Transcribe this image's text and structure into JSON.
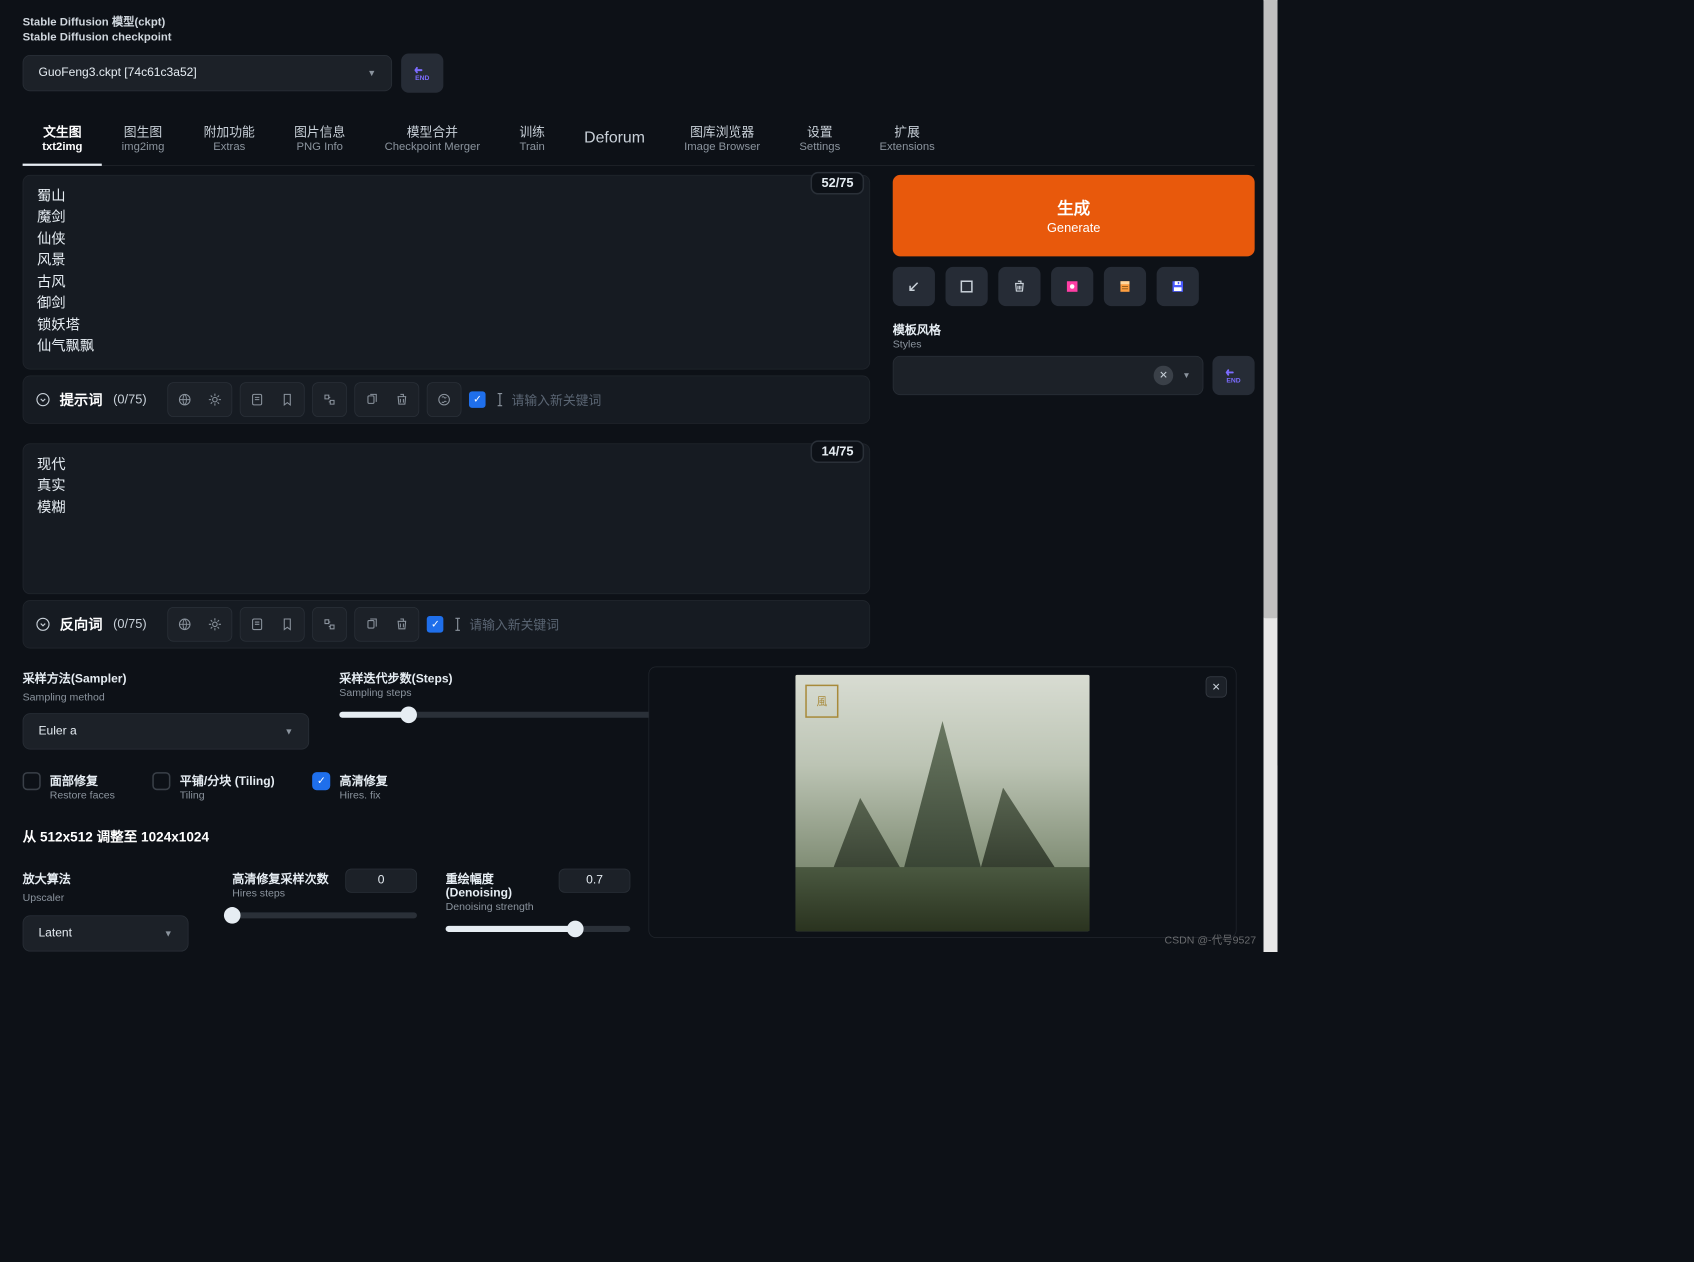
{
  "header": {
    "label_cn": "Stable Diffusion 模型(ckpt)",
    "label_en": "Stable Diffusion checkpoint",
    "checkpoint": "GuoFeng3.ckpt [74c61c3a52]"
  },
  "tabs": [
    {
      "cn": "文生图",
      "en": "txt2img",
      "active": true
    },
    {
      "cn": "图生图",
      "en": "img2img"
    },
    {
      "cn": "附加功能",
      "en": "Extras"
    },
    {
      "cn": "图片信息",
      "en": "PNG Info"
    },
    {
      "cn": "模型合并",
      "en": "Checkpoint Merger"
    },
    {
      "cn": "训练",
      "en": "Train"
    },
    {
      "cn": "Deforum",
      "en": "",
      "single": true
    },
    {
      "cn": "图库浏览器",
      "en": "Image Browser"
    },
    {
      "cn": "设置",
      "en": "Settings"
    },
    {
      "cn": "扩展",
      "en": "Extensions"
    }
  ],
  "prompt": {
    "counter": "52/75",
    "text": "蜀山\n魔剑\n仙侠\n风景\n古风\n御剑\n锁妖塔\n仙气飘飘",
    "toolbar_title": "提示词",
    "toolbar_count": "(0/75)",
    "keyword_placeholder": "请输入新关键词"
  },
  "neg_prompt": {
    "counter": "14/75",
    "text": "现代\n真实\n模糊",
    "toolbar_title": "反向词",
    "toolbar_count": "(0/75)",
    "keyword_placeholder": "请输入新关键词"
  },
  "sampler": {
    "label_cn": "采样方法(Sampler)",
    "label_en": "Sampling method",
    "value": "Euler a"
  },
  "steps": {
    "label_cn": "采样迭代步数(Steps)",
    "label_en": "Sampling steps",
    "value": "20",
    "percent": 13
  },
  "checks": {
    "restore_cn": "面部修复",
    "restore_en": "Restore faces",
    "restore_on": false,
    "tiling_cn": "平铺/分块 (Tiling)",
    "tiling_en": "Tiling",
    "tiling_on": false,
    "hires_cn": "高清修复",
    "hires_en": "Hires. fix",
    "hires_on": true
  },
  "resize_line": "从 512x512 调整至 1024x1024",
  "upscaler": {
    "label_cn": "放大算法",
    "label_en": "Upscaler",
    "value": "Latent"
  },
  "hires_steps": {
    "label_cn": "高清修复采样次数",
    "label_en": "Hires steps",
    "value": "0",
    "percent": 0
  },
  "denoise": {
    "label_cn": "重绘幅度(Denoising)",
    "label_en": "Denoising strength",
    "value": "0.7",
    "percent": 70
  },
  "generate": {
    "cn": "生成",
    "en": "Generate"
  },
  "styles": {
    "label_cn": "模板风格",
    "label_en": "Styles"
  },
  "watermark": "CSDN @-代号9527"
}
